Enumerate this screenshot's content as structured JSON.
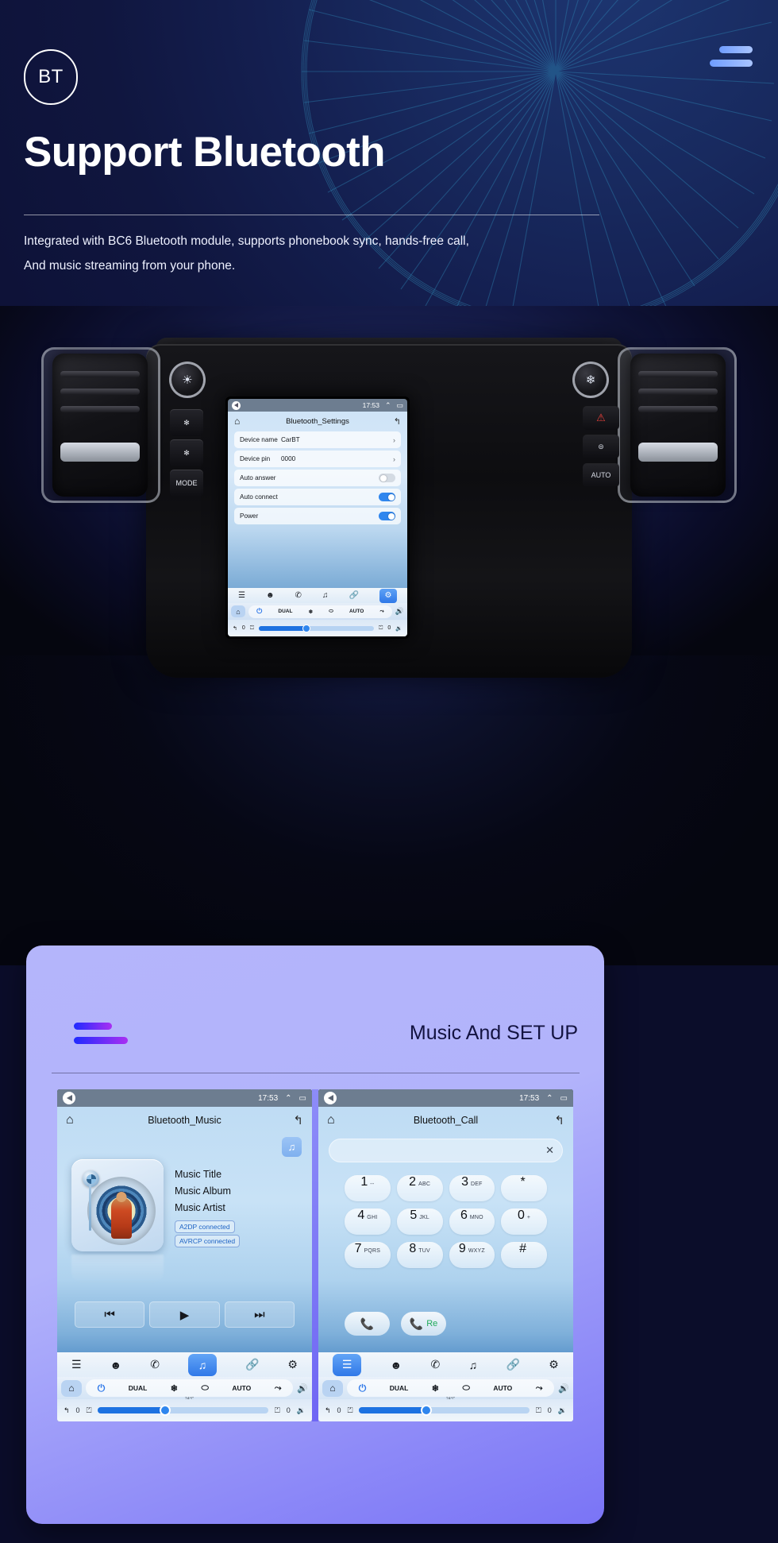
{
  "hero": {
    "badge": "BT",
    "menu_icon": "hamburger-icon",
    "title": "Support Bluetooth",
    "subtitle_line1": "Integrated with BC6 Bluetooth module, supports phonebook sync, hands-free call,",
    "subtitle_line2": "And music streaming from your phone."
  },
  "head_unit": {
    "status": {
      "time": "17:53",
      "back_icon": "back-icon",
      "up_icon": "chevron-up-icon",
      "window_icon": "recents-icon"
    },
    "home_icon": "home-icon",
    "title": "Bluetooth_Settings",
    "return_icon": "return-icon",
    "rows": [
      {
        "label": "Device name",
        "value": "CarBT",
        "control": "chevron"
      },
      {
        "label": "Device pin",
        "value": "0000",
        "control": "chevron"
      },
      {
        "label": "Auto answer",
        "value": "",
        "control": "toggle-off"
      },
      {
        "label": "Auto connect",
        "value": "",
        "control": "toggle-on"
      },
      {
        "label": "Power",
        "value": "",
        "control": "toggle-on"
      }
    ],
    "tabs": [
      "apps-icon",
      "contact-icon",
      "phone-icon",
      "music-icon",
      "link-icon",
      "settings-icon"
    ],
    "selected_tab": 5,
    "climate": {
      "power": "power-icon",
      "dual": "DUAL",
      "snow": "snowflake-icon",
      "defrost": "defrost-icon",
      "auto": "AUTO",
      "fan": "fan-icon",
      "volume_up": "volume-up-icon",
      "ac_note": "A/C"
    },
    "seat": {
      "left_value": "0",
      "right_value": "0",
      "back_icon": "back-arrow-icon",
      "seat_left_icon": "seat-icon",
      "seat_right_icon": "seat-heat-icon",
      "volume_down": "volume-down-icon"
    },
    "console": {
      "left_knob_icon": "light-knob",
      "right_knob_icon": "fan-knob",
      "buttons": [
        "fan-icon",
        "snow-icon",
        "MODE"
      ],
      "right_buttons": [
        "hazard-icon",
        "rear-defrost-icon",
        "AUTO"
      ]
    }
  },
  "panel": {
    "title": "Music And SET UP",
    "bars_icon": "gradient-bars-icon"
  },
  "music_screen": {
    "status": {
      "time": "17:53"
    },
    "home_icon": "home-icon",
    "title": "Bluetooth_Music",
    "return_icon": "return-icon",
    "note_button_icon": "music-note-icon",
    "track": {
      "title": "Music Title",
      "album": "Music Album",
      "artist": "Music Artist"
    },
    "badges": [
      "A2DP  connected",
      "AVRCP connected"
    ],
    "transport": [
      "prev-icon",
      "play-icon",
      "next-icon"
    ],
    "tabs": [
      "apps-icon",
      "contact-icon",
      "phone-icon",
      "music-icon",
      "link-icon",
      "settings-icon"
    ],
    "selected_tab": 3,
    "climate": {
      "power": "power-icon",
      "dual": "DUAL",
      "snow": "snowflake-icon",
      "defrost": "defrost-icon",
      "auto": "AUTO",
      "fan": "fan-icon",
      "ac_note": "24°C",
      "volume_up": "volume-up-icon"
    },
    "seat": {
      "left_value": "0",
      "right_value": "0"
    }
  },
  "call_screen": {
    "status": {
      "time": "17:53"
    },
    "home_icon": "home-icon",
    "title": "Bluetooth_Call",
    "return_icon": "return-icon",
    "input_value": "",
    "clear_icon": "clear-icon",
    "keys": [
      {
        "digit": "1",
        "sub": "--"
      },
      {
        "digit": "2",
        "sub": "ABC"
      },
      {
        "digit": "3",
        "sub": "DEF"
      },
      {
        "digit": "*",
        "sub": ""
      },
      {
        "digit": "4",
        "sub": "GHI"
      },
      {
        "digit": "5",
        "sub": "JKL"
      },
      {
        "digit": "6",
        "sub": "MNO"
      },
      {
        "digit": "0",
        "sub": "+"
      },
      {
        "digit": "7",
        "sub": "PQRS"
      },
      {
        "digit": "8",
        "sub": "TUV"
      },
      {
        "digit": "9",
        "sub": "WXYZ"
      },
      {
        "digit": "#",
        "sub": ""
      }
    ],
    "call_button": {
      "icon": "phone-icon",
      "label": ""
    },
    "redial_button": {
      "icon": "phone-icon",
      "label": "Re"
    },
    "tabs": [
      "apps-icon",
      "contact-icon",
      "phone-icon",
      "music-icon",
      "link-icon",
      "settings-icon"
    ],
    "selected_tab": 0,
    "climate": {
      "power": "power-icon",
      "dual": "DUAL",
      "snow": "snowflake-icon",
      "defrost": "defrost-icon",
      "auto": "AUTO",
      "fan": "fan-icon",
      "ac_note": "24°C"
    },
    "seat": {
      "left_value": "0",
      "right_value": "0"
    }
  },
  "colors": {
    "hero_bg": "#141c4e",
    "panel_bg": "#b4b5fb",
    "accent_blue": "#2f78e8",
    "status_bar": "#6d7d90",
    "green": "#1faa5a"
  }
}
